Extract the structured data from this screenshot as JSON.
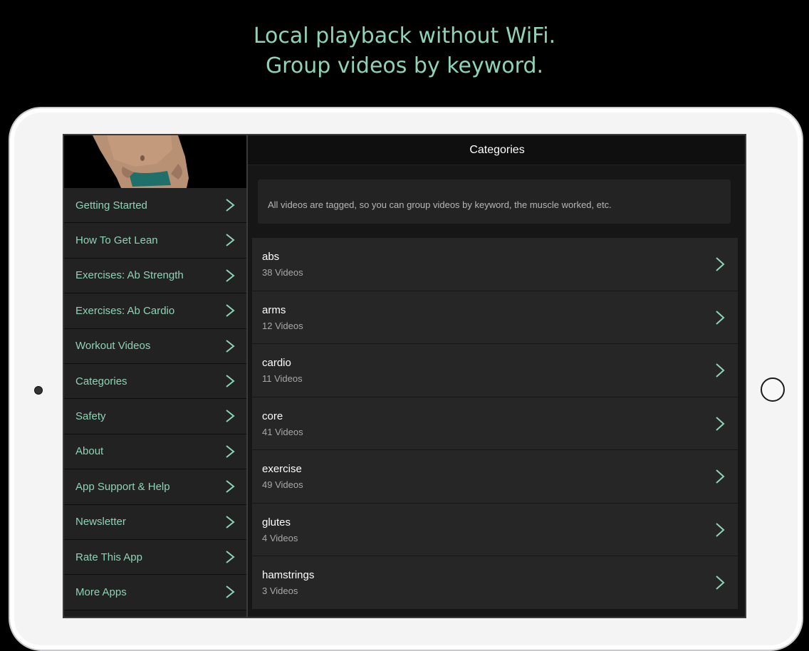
{
  "headline": {
    "line1": "Local playback without WiFi.",
    "line2": "Group videos by keyword."
  },
  "colors": {
    "accent": "#8fd3b6",
    "background": "#000000",
    "panel": "#262626"
  },
  "header": {
    "title": "Categories"
  },
  "intro": {
    "text": "All videos are tagged, so you can group videos by keyword, the muscle worked, etc."
  },
  "sidebar": {
    "items": [
      {
        "label": "Getting Started"
      },
      {
        "label": "How To Get Lean"
      },
      {
        "label": "Exercises: Ab Strength"
      },
      {
        "label": "Exercises: Ab Cardio"
      },
      {
        "label": "Workout Videos"
      },
      {
        "label": "Categories"
      },
      {
        "label": "Safety"
      },
      {
        "label": "About"
      },
      {
        "label": "App Support & Help"
      },
      {
        "label": "Newsletter"
      },
      {
        "label": "Rate This App"
      },
      {
        "label": "More Apps"
      }
    ]
  },
  "categories": [
    {
      "name": "abs",
      "count": "38 Videos"
    },
    {
      "name": "arms",
      "count": "12 Videos"
    },
    {
      "name": "cardio",
      "count": "11 Videos"
    },
    {
      "name": "core",
      "count": "41 Videos"
    },
    {
      "name": "exercise",
      "count": "49 Videos"
    },
    {
      "name": "glutes",
      "count": "4 Videos"
    },
    {
      "name": "hamstrings",
      "count": "3 Videos"
    }
  ]
}
